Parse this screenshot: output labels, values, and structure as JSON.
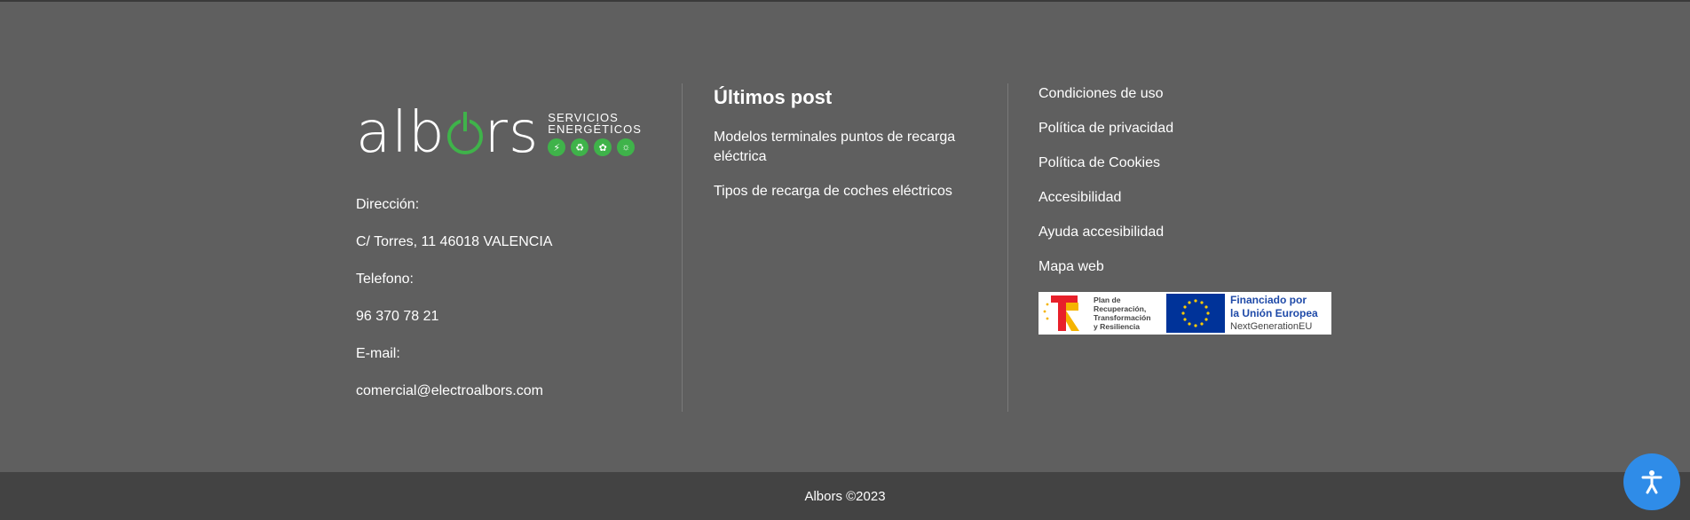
{
  "brand": {
    "logo_word": "alb",
    "logo_word_end": "rs",
    "logo_tagline_1": "SERVICIOS",
    "logo_tagline_2": "ENERGÉTICOS",
    "accent_color": "#3fb34a",
    "logo_icons": [
      "lightning-icon",
      "recycle-icon",
      "plant-icon",
      "lightbulb-icon"
    ]
  },
  "contact": {
    "address_label": "Dirección:",
    "address_value": "C/ Torres, 11 46018 VALENCIA",
    "phone_label": "Telefono:",
    "phone_value": "96 370 78 21",
    "email_label": "E-mail:",
    "email_value": "comercial@electroalbors.com"
  },
  "posts": {
    "heading": "Últimos post",
    "items": [
      {
        "label": "Modelos terminales puntos de recarga eléctrica"
      },
      {
        "label": "Tipos de recarga de coches eléctricos"
      }
    ]
  },
  "legal": {
    "items": [
      {
        "label": "Condiciones de uso"
      },
      {
        "label": "Política de privacidad"
      },
      {
        "label": "Política de Cookies"
      },
      {
        "label": "Accesibilidad"
      },
      {
        "label": "Ayuda accesibilidad"
      },
      {
        "label": "Mapa web"
      }
    ]
  },
  "funding": {
    "plan_line_1": "Plan de",
    "plan_line_2": "Recuperación,",
    "plan_line_3": "Transformación",
    "plan_line_4": "y Resiliencia",
    "eu_line_1": "Financiado por",
    "eu_line_2": "la Unión Europea",
    "eu_line_3": "NextGenerationEU"
  },
  "bottom": {
    "copyright": "Albors ©2023"
  },
  "accessibility_button": {
    "icon": "accessibility-icon",
    "color": "#2f8ce8"
  }
}
